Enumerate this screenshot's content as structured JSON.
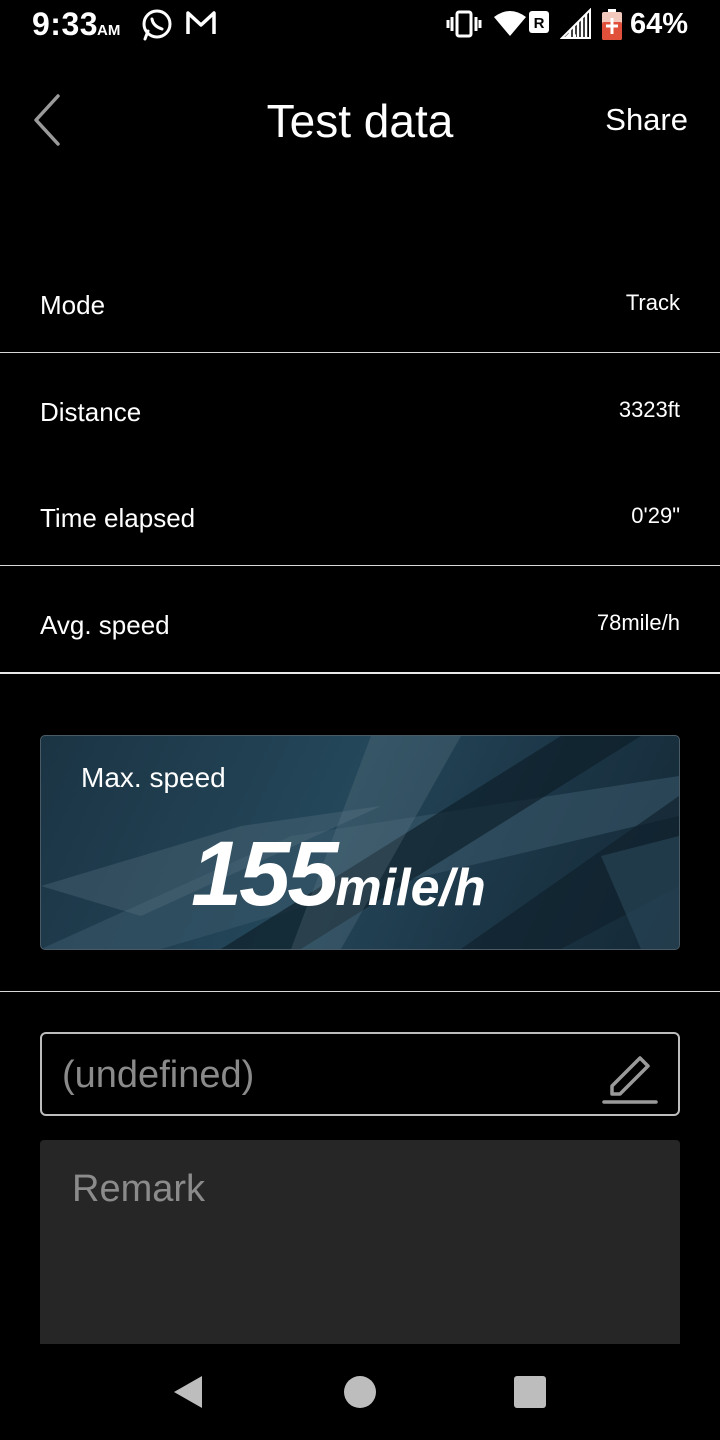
{
  "status_bar": {
    "time": "9:33",
    "ampm": "AM",
    "battery_percent": "64%",
    "icons": [
      "whatsapp-icon",
      "gmail-icon",
      "vibrate-icon",
      "wifi-icon",
      "roaming-icon",
      "signal-icon",
      "battery-icon"
    ]
  },
  "header": {
    "title": "Test data",
    "share_label": "Share",
    "back_icon": "chevron-left-icon"
  },
  "rows": [
    {
      "label": "Mode",
      "value": "Track"
    },
    {
      "label": "Distance",
      "value": "3323ft"
    },
    {
      "label": "Time elapsed",
      "value": "0'29\""
    },
    {
      "label": "Avg. speed",
      "value": "78mile/h"
    }
  ],
  "max_speed": {
    "label": "Max. speed",
    "value": "155",
    "unit": "mile/h"
  },
  "name_field": {
    "value": "(undefined)",
    "edit_icon": "pencil-icon"
  },
  "remark": {
    "placeholder": "Remark"
  },
  "nav_bar": {
    "icons": [
      "back-triangle-icon",
      "home-circle-icon",
      "recents-square-icon"
    ]
  },
  "colors": {
    "background": "#000000",
    "card_gradient_start": "#1b3444",
    "remark_bg": "#262626"
  }
}
